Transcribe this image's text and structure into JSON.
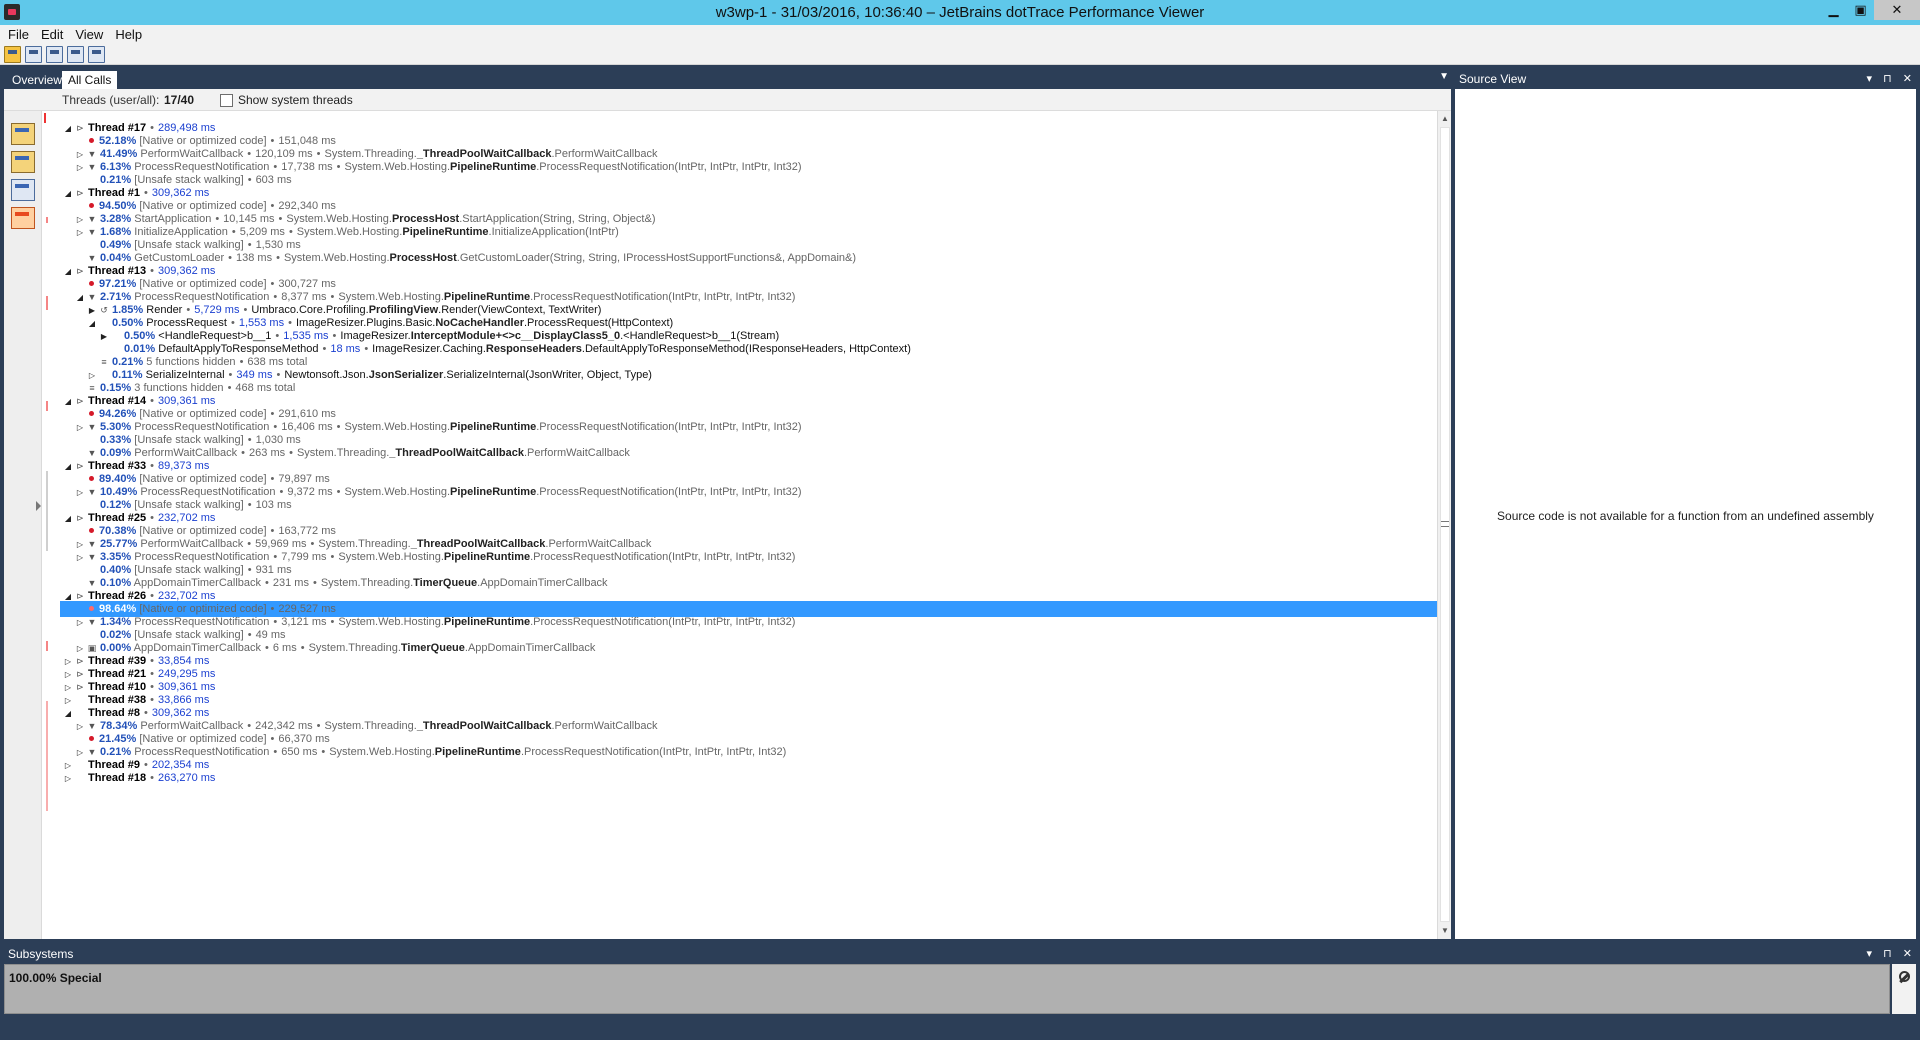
{
  "window": {
    "title": "w3wp-1 - 31/03/2016, 10:36:40 – JetBrains dotTrace Performance Viewer",
    "minimize": "▁",
    "restore": "▣",
    "close": "✕"
  },
  "menu": [
    "File",
    "Edit",
    "View",
    "Help"
  ],
  "toolbar_icons": [
    "open-icon",
    "save-icon",
    "save-as-icon",
    "snapshot-icon",
    "compare-icon"
  ],
  "tabs": [
    {
      "label": "Overview",
      "active": false
    },
    {
      "label": "All Calls",
      "active": true
    }
  ],
  "threads_bar": {
    "label": "Threads (user/all):",
    "value": "17/40",
    "checkbox_label": "Show system threads"
  },
  "tree_rows": [
    {
      "indent": 0,
      "toggle": "◢",
      "icon": "⊳",
      "pct": "",
      "func": "Thread #17",
      "time": "289,498 ms",
      "ns": "",
      "kind": "thread"
    },
    {
      "indent": 1,
      "toggle": "",
      "icon": "dot",
      "pct": "52.18%",
      "func": "[Native or optimized code]",
      "time": "151,048 ms",
      "ns": "",
      "kind": ""
    },
    {
      "indent": 1,
      "toggle": "▷",
      "icon": "▼",
      "pct": "41.49%",
      "func": "PerformWaitCallback",
      "time": "120,109 ms",
      "ns": "System.Threading.",
      "cls": "_ThreadPoolWaitCallback",
      "tail": ".PerformWaitCallback",
      "kind": ""
    },
    {
      "indent": 1,
      "toggle": "▷",
      "icon": "▼",
      "pct": "6.13%",
      "func": "ProcessRequestNotification",
      "time": "17,738 ms",
      "ns": "System.Web.Hosting.",
      "cls": "PipelineRuntime",
      "tail": ".ProcessRequestNotification(IntPtr, IntPtr, IntPtr, Int32)",
      "kind": ""
    },
    {
      "indent": 1,
      "toggle": "",
      "icon": "",
      "pct": "0.21%",
      "func": "[Unsafe stack walking]",
      "time": "603 ms",
      "ns": "",
      "kind": ""
    },
    {
      "indent": 0,
      "toggle": "◢",
      "icon": "⊳",
      "pct": "",
      "func": "Thread #1",
      "time": "309,362 ms",
      "ns": "",
      "kind": "thread"
    },
    {
      "indent": 1,
      "toggle": "",
      "icon": "dot",
      "pct": "94.50%",
      "func": "[Native or optimized code]",
      "time": "292,340 ms",
      "ns": "",
      "kind": ""
    },
    {
      "indent": 1,
      "toggle": "▷",
      "icon": "▼",
      "pct": "3.28%",
      "func": "StartApplication",
      "time": "10,145 ms",
      "ns": "System.Web.Hosting.",
      "cls": "ProcessHost",
      "tail": ".StartApplication(String, String, Object&)",
      "kind": ""
    },
    {
      "indent": 1,
      "toggle": "▷",
      "icon": "▼",
      "pct": "1.68%",
      "func": "InitializeApplication",
      "time": "5,209 ms",
      "ns": "System.Web.Hosting.",
      "cls": "PipelineRuntime",
      "tail": ".InitializeApplication(IntPtr)",
      "kind": ""
    },
    {
      "indent": 1,
      "toggle": "",
      "icon": "",
      "pct": "0.49%",
      "func": "[Unsafe stack walking]",
      "time": "1,530 ms",
      "ns": "",
      "kind": ""
    },
    {
      "indent": 1,
      "toggle": "",
      "icon": "▼",
      "pct": "0.04%",
      "func": "GetCustomLoader",
      "time": "138 ms",
      "ns": "System.Web.Hosting.",
      "cls": "ProcessHost",
      "tail": ".GetCustomLoader(String, String, IProcessHostSupportFunctions&, AppDomain&)",
      "kind": ""
    },
    {
      "indent": 0,
      "toggle": "◢",
      "icon": "⊳",
      "pct": "",
      "func": "Thread #13",
      "time": "309,362 ms",
      "ns": "",
      "kind": "thread"
    },
    {
      "indent": 1,
      "toggle": "",
      "icon": "dot",
      "pct": "97.21%",
      "func": "[Native or optimized code]",
      "time": "300,727 ms",
      "ns": "",
      "kind": ""
    },
    {
      "indent": 1,
      "toggle": "◢",
      "icon": "▼",
      "pct": "2.71%",
      "func": "ProcessRequestNotification",
      "time": "8,377 ms",
      "ns": "System.Web.Hosting.",
      "cls": "PipelineRuntime",
      "tail": ".ProcessRequestNotification(IntPtr, IntPtr, IntPtr, Int32)",
      "kind": ""
    },
    {
      "indent": 2,
      "toggle": "▶",
      "icon": "↺",
      "pct": "1.85%",
      "func": "Render",
      "time": "5,729 ms",
      "ns": "Umbraco.Core.Profiling.",
      "cls": "ProfilingView",
      "tail": ".Render(ViewContext, TextWriter)",
      "kind": "hl"
    },
    {
      "indent": 2,
      "toggle": "◢",
      "icon": "",
      "pct": "0.50%",
      "func": "ProcessRequest",
      "time": "1,553 ms",
      "ns": "ImageResizer.Plugins.Basic.",
      "cls": "NoCacheHandler",
      "tail": ".ProcessRequest(HttpContext)",
      "kind": "hl"
    },
    {
      "indent": 3,
      "toggle": "▶",
      "icon": "",
      "pct": "0.50%",
      "func": "<HandleRequest>b__1",
      "time": "1,535 ms",
      "ns": "ImageResizer.",
      "cls": "InterceptModule+<>c__DisplayClass5_0",
      "tail": ".<HandleRequest>b__1(Stream)",
      "kind": "hl"
    },
    {
      "indent": 3,
      "toggle": "",
      "icon": "",
      "pct": "0.01%",
      "func": "DefaultApplyToResponseMethod",
      "time": "18 ms",
      "ns": "ImageResizer.Caching.",
      "cls": "ResponseHeaders",
      "tail": ".DefaultApplyToResponseMethod(IResponseHeaders, HttpContext)",
      "kind": "hl"
    },
    {
      "indent": 2,
      "toggle": "",
      "icon": "≡",
      "pct": "0.21%",
      "func": "5 functions hidden",
      "time": "638 ms total",
      "ns": "",
      "kind": ""
    },
    {
      "indent": 2,
      "toggle": "▷",
      "icon": "",
      "pct": "0.11%",
      "func": "SerializeInternal",
      "time": "349 ms",
      "ns": "Newtonsoft.Json.",
      "cls": "JsonSerializer",
      "tail": ".SerializeInternal(JsonWriter, Object, Type)",
      "kind": "hl"
    },
    {
      "indent": 1,
      "toggle": "",
      "icon": "≡",
      "pct": "0.15%",
      "func": "3 functions hidden",
      "time": "468 ms total",
      "ns": "",
      "kind": ""
    },
    {
      "indent": 0,
      "toggle": "◢",
      "icon": "⊳",
      "pct": "",
      "func": "Thread #14",
      "time": "309,361 ms",
      "ns": "",
      "kind": "thread"
    },
    {
      "indent": 1,
      "toggle": "",
      "icon": "dot",
      "pct": "94.26%",
      "func": "[Native or optimized code]",
      "time": "291,610 ms",
      "ns": "",
      "kind": ""
    },
    {
      "indent": 1,
      "toggle": "▷",
      "icon": "▼",
      "pct": "5.30%",
      "func": "ProcessRequestNotification",
      "time": "16,406 ms",
      "ns": "System.Web.Hosting.",
      "cls": "PipelineRuntime",
      "tail": ".ProcessRequestNotification(IntPtr, IntPtr, IntPtr, Int32)",
      "kind": ""
    },
    {
      "indent": 1,
      "toggle": "",
      "icon": "",
      "pct": "0.33%",
      "func": "[Unsafe stack walking]",
      "time": "1,030 ms",
      "ns": "",
      "kind": ""
    },
    {
      "indent": 1,
      "toggle": "",
      "icon": "▼",
      "pct": "0.09%",
      "func": "PerformWaitCallback",
      "time": "263 ms",
      "ns": "System.Threading.",
      "cls": "_ThreadPoolWaitCallback",
      "tail": ".PerformWaitCallback",
      "kind": ""
    },
    {
      "indent": 0,
      "toggle": "◢",
      "icon": "⊳",
      "pct": "",
      "func": "Thread #33",
      "time": "89,373 ms",
      "ns": "",
      "kind": "thread"
    },
    {
      "indent": 1,
      "toggle": "",
      "icon": "dot",
      "pct": "89.40%",
      "func": "[Native or optimized code]",
      "time": "79,897 ms",
      "ns": "",
      "kind": ""
    },
    {
      "indent": 1,
      "toggle": "▷",
      "icon": "▼",
      "pct": "10.49%",
      "func": "ProcessRequestNotification",
      "time": "9,372 ms",
      "ns": "System.Web.Hosting.",
      "cls": "PipelineRuntime",
      "tail": ".ProcessRequestNotification(IntPtr, IntPtr, IntPtr, Int32)",
      "kind": ""
    },
    {
      "indent": 1,
      "toggle": "",
      "icon": "",
      "pct": "0.12%",
      "func": "[Unsafe stack walking]",
      "time": "103 ms",
      "ns": "",
      "kind": ""
    },
    {
      "indent": 0,
      "toggle": "◢",
      "icon": "⊳",
      "pct": "",
      "func": "Thread #25",
      "time": "232,702 ms",
      "ns": "",
      "kind": "thread"
    },
    {
      "indent": 1,
      "toggle": "",
      "icon": "dot",
      "pct": "70.38%",
      "func": "[Native or optimized code]",
      "time": "163,772 ms",
      "ns": "",
      "kind": ""
    },
    {
      "indent": 1,
      "toggle": "▷",
      "icon": "▼",
      "pct": "25.77%",
      "func": "PerformWaitCallback",
      "time": "59,969 ms",
      "ns": "System.Threading.",
      "cls": "_ThreadPoolWaitCallback",
      "tail": ".PerformWaitCallback",
      "kind": ""
    },
    {
      "indent": 1,
      "toggle": "▷",
      "icon": "▼",
      "pct": "3.35%",
      "func": "ProcessRequestNotification",
      "time": "7,799 ms",
      "ns": "System.Web.Hosting.",
      "cls": "PipelineRuntime",
      "tail": ".ProcessRequestNotification(IntPtr, IntPtr, IntPtr, Int32)",
      "kind": ""
    },
    {
      "indent": 1,
      "toggle": "",
      "icon": "",
      "pct": "0.40%",
      "func": "[Unsafe stack walking]",
      "time": "931 ms",
      "ns": "",
      "kind": ""
    },
    {
      "indent": 1,
      "toggle": "",
      "icon": "▼",
      "pct": "0.10%",
      "func": "AppDomainTimerCallback",
      "time": "231 ms",
      "ns": "System.Threading.",
      "cls": "TimerQueue",
      "tail": ".AppDomainTimerCallback",
      "kind": ""
    },
    {
      "indent": 0,
      "toggle": "◢",
      "icon": "⊳",
      "pct": "",
      "func": "Thread #26",
      "time": "232,702 ms",
      "ns": "",
      "kind": "thread"
    },
    {
      "indent": 1,
      "toggle": "",
      "icon": "dot",
      "pct": "98.64%",
      "func": "[Native or optimized code]",
      "time": "229,527 ms",
      "ns": "",
      "kind": "sel"
    },
    {
      "indent": 1,
      "toggle": "▷",
      "icon": "▼",
      "pct": "1.34%",
      "func": "ProcessRequestNotification",
      "time": "3,121 ms",
      "ns": "System.Web.Hosting.",
      "cls": "PipelineRuntime",
      "tail": ".ProcessRequestNotification(IntPtr, IntPtr, IntPtr, Int32)",
      "kind": ""
    },
    {
      "indent": 1,
      "toggle": "",
      "icon": "",
      "pct": "0.02%",
      "func": "[Unsafe stack walking]",
      "time": "49 ms",
      "ns": "",
      "kind": ""
    },
    {
      "indent": 1,
      "toggle": "▷",
      "icon": "▣",
      "pct": "0.00%",
      "func": "AppDomainTimerCallback",
      "time": "6 ms",
      "ns": "System.Threading.",
      "cls": "TimerQueue",
      "tail": ".AppDomainTimerCallback",
      "kind": ""
    },
    {
      "indent": 0,
      "toggle": "▷",
      "icon": "⊳",
      "pct": "",
      "func": "Thread #39",
      "time": "33,854 ms",
      "ns": "",
      "kind": "thread"
    },
    {
      "indent": 0,
      "toggle": "▷",
      "icon": "⊳",
      "pct": "",
      "func": "Thread #21",
      "time": "249,295 ms",
      "ns": "",
      "kind": "thread"
    },
    {
      "indent": 0,
      "toggle": "▷",
      "icon": "⊳",
      "pct": "",
      "func": "Thread #10",
      "time": "309,361 ms",
      "ns": "",
      "kind": "thread"
    },
    {
      "indent": 0,
      "toggle": "▷",
      "icon": "",
      "pct": "",
      "func": "Thread #38",
      "time": "33,866 ms",
      "ns": "",
      "kind": "thread"
    },
    {
      "indent": 0,
      "toggle": "◢",
      "icon": "",
      "pct": "",
      "func": "Thread #8",
      "time": "309,362 ms",
      "ns": "",
      "kind": "thread"
    },
    {
      "indent": 1,
      "toggle": "▷",
      "icon": "▼",
      "pct": "78.34%",
      "func": "PerformWaitCallback",
      "time": "242,342 ms",
      "ns": "System.Threading.",
      "cls": "_ThreadPoolWaitCallback",
      "tail": ".PerformWaitCallback",
      "kind": ""
    },
    {
      "indent": 1,
      "toggle": "",
      "icon": "dot",
      "pct": "21.45%",
      "func": "[Native or optimized code]",
      "time": "66,370 ms",
      "ns": "",
      "kind": ""
    },
    {
      "indent": 1,
      "toggle": "▷",
      "icon": "▼",
      "pct": "0.21%",
      "func": "ProcessRequestNotification",
      "time": "650 ms",
      "ns": "System.Web.Hosting.",
      "cls": "PipelineRuntime",
      "tail": ".ProcessRequestNotification(IntPtr, IntPtr, IntPtr, Int32)",
      "kind": ""
    },
    {
      "indent": 0,
      "toggle": "▷",
      "icon": "",
      "pct": "",
      "func": "Thread #9",
      "time": "202,354 ms",
      "ns": "",
      "kind": "thread"
    },
    {
      "indent": 0,
      "toggle": "▷",
      "icon": "",
      "pct": "",
      "func": "Thread #18",
      "time": "263,270 ms",
      "ns": "",
      "kind": "thread"
    }
  ],
  "source_view": {
    "title": "Source View",
    "pin": "▾",
    "dock": "⊓",
    "close": "✕",
    "message": "Source code is not available for a function from an undefined assembly"
  },
  "subsystems": {
    "title": "Subsystems",
    "value": "100.00% Special"
  }
}
